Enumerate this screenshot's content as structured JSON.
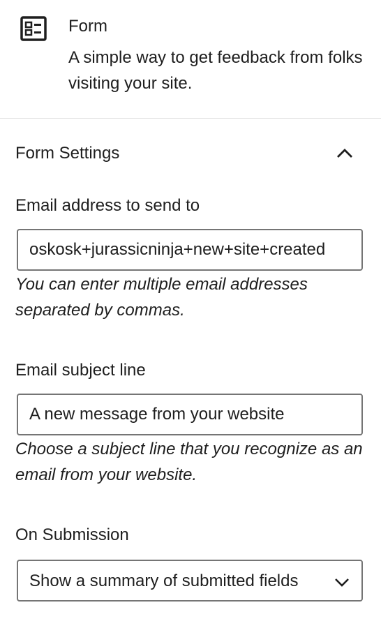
{
  "block": {
    "icon": "form-block-icon",
    "title": "Form",
    "description": "A simple way to get feedback from folks visiting your site."
  },
  "panel": {
    "title": "Form Settings",
    "expanded": true,
    "toggle_icon": "chevron-up-icon"
  },
  "fields": {
    "email_to": {
      "label": "Email address to send to",
      "value": "oskosk+jurassicninja+new+site+created",
      "help": "You can enter multiple email addresses separated by commas."
    },
    "subject": {
      "label": "Email subject line",
      "value": "A new message from your website",
      "help": "Choose a subject line that you recognize as an email from your website."
    },
    "on_submission": {
      "label": "On Submission",
      "selected": "Show a summary of submitted fields",
      "icon": "chevron-down-icon"
    }
  }
}
